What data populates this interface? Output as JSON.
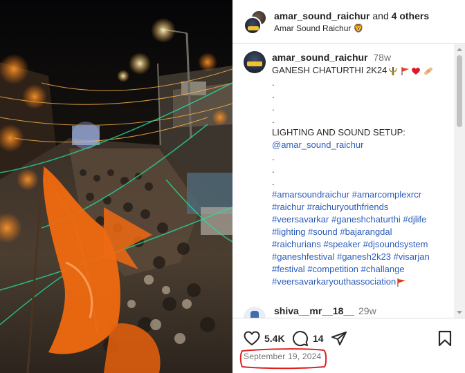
{
  "header": {
    "username": "amar_sound_raichur",
    "joiner": "and",
    "others": "4 others",
    "subtitle": "Amar Sound Raichur 🦁"
  },
  "caption": {
    "username": "amar_sound_raichur",
    "age": "78w",
    "title": "GANESH CHATURTHI 2K24",
    "dot": ".",
    "setup_line": "LIGHTING AND SOUND SETUP:",
    "mention": "@amar_sound_raichur",
    "hashtags": [
      [
        "#amarsoundraichur",
        "#amarcomplexrcr"
      ],
      [
        "#raichur",
        "#raichuryouthfriends"
      ],
      [
        "#veersavarkar",
        "#ganeshchaturthi",
        "#djlife"
      ],
      [
        "#lighting",
        "#sound",
        "#bajarangdal"
      ],
      [
        "#raichurians",
        "#speaker",
        "#djsoundsystem"
      ],
      [
        "#ganeshfestival",
        "#ganesh2k23",
        "#visarjan"
      ],
      [
        "#festival",
        "#competition",
        "#challange"
      ],
      [
        "#veersavarkaryouthassociation"
      ]
    ]
  },
  "comment": {
    "username": "shiva__mr__18__",
    "age": "29w"
  },
  "actions": {
    "likes": "5.4K",
    "comments": "14"
  },
  "date": "September 19, 2024",
  "icons": {
    "like": "heart-icon",
    "comment": "comment-bubble-icon",
    "share": "paper-plane-icon",
    "save": "bookmark-icon"
  },
  "colors": {
    "link": "#2b5dbb",
    "annotation": "#e02020",
    "muted": "#737373"
  }
}
